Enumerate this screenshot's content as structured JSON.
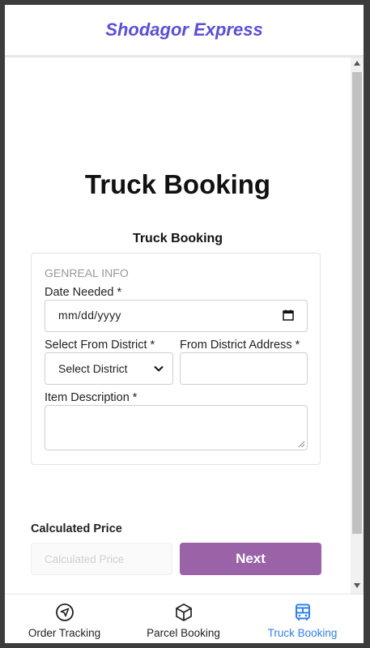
{
  "header": {
    "brand": "Shodagor Express"
  },
  "main": {
    "page_title": "Truck Booking",
    "section_title": "Truck Booking",
    "form": {
      "group_label": "GENREAL INFO",
      "date_label": "Date Needed *",
      "date_value": "mm/dd/yyyy",
      "from_district_label": "Select From District *",
      "from_district_value": "Select District",
      "from_address_label": "From District Address *",
      "from_address_value": "",
      "item_desc_label": "Item Description *",
      "item_desc_value": ""
    },
    "price": {
      "label": "Calculated Price",
      "placeholder": "Calculated Price"
    },
    "next_label": "Next"
  },
  "bottom_nav": {
    "items": [
      {
        "label": "Order Tracking",
        "icon": "navigation-arrow-icon",
        "active": false
      },
      {
        "label": "Parcel Booking",
        "icon": "box-icon",
        "active": false
      },
      {
        "label": "Truck Booking",
        "icon": "truck-icon",
        "active": true
      }
    ]
  },
  "colors": {
    "brand": "#5a4fd6",
    "primary_button": "#9a63a8",
    "active_nav": "#2f80ed"
  }
}
